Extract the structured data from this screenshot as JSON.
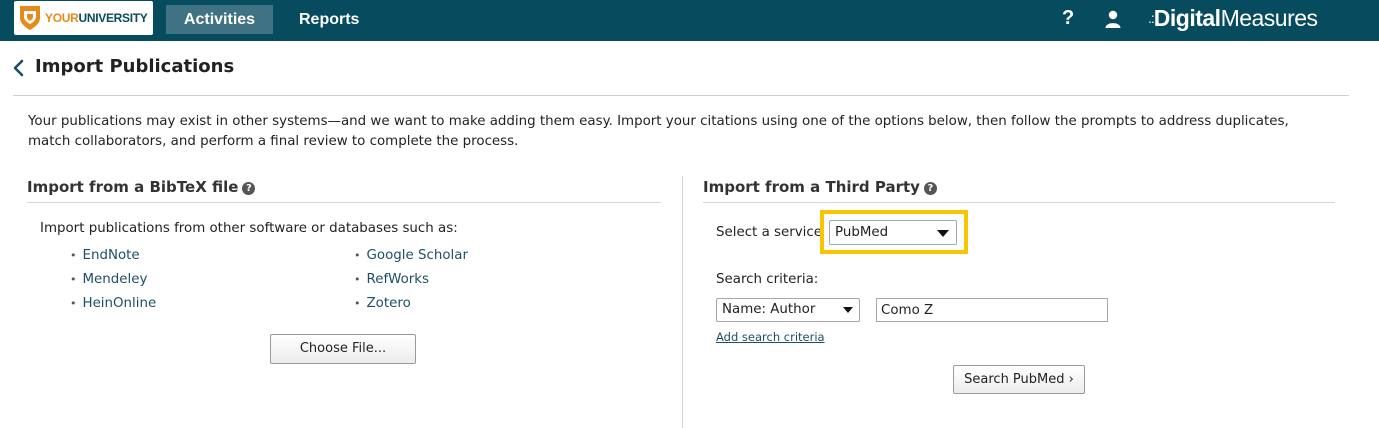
{
  "nav": {
    "logo": {
      "part1": "YOUR",
      "part2": "UNIVERSITY"
    },
    "tabs": [
      {
        "label": "Activities",
        "active": true
      },
      {
        "label": "Reports",
        "active": false
      }
    ],
    "help_label": "?",
    "brand": {
      "dots": ".:",
      "bold": "Digital",
      "light": "Measures"
    }
  },
  "page": {
    "title": "Import Publications",
    "intro": "Your publications may exist in other systems—and we want to make adding them easy. Import your citations using one of the options below, then follow the prompts to address duplicates, match collaborators, and perform a final review to complete the process."
  },
  "bibtex": {
    "title": "Import from a BibTeX file",
    "help": "?",
    "intro": "Import publications from other software or databases such as:",
    "sources_col1": [
      "EndNote",
      "Mendeley",
      "HeinOnline"
    ],
    "sources_col2": [
      "Google Scholar",
      "RefWorks",
      "Zotero"
    ],
    "bullet": "•",
    "choose_button": "Choose File..."
  },
  "third_party": {
    "title": "Import from a Third Party",
    "help": "?",
    "service_label": "Select a service",
    "service_value": "PubMed",
    "criteria_label": "Search criteria:",
    "criteria_field": "Name: Author",
    "criteria_value": "Como Z",
    "add_criteria": "Add search criteria",
    "search_button": "Search PubMed ›"
  },
  "colors": {
    "nav_bg": "#064b5e",
    "active_tab": "#3f7383",
    "highlight": "#f7c600",
    "link": "#1d4f66"
  }
}
